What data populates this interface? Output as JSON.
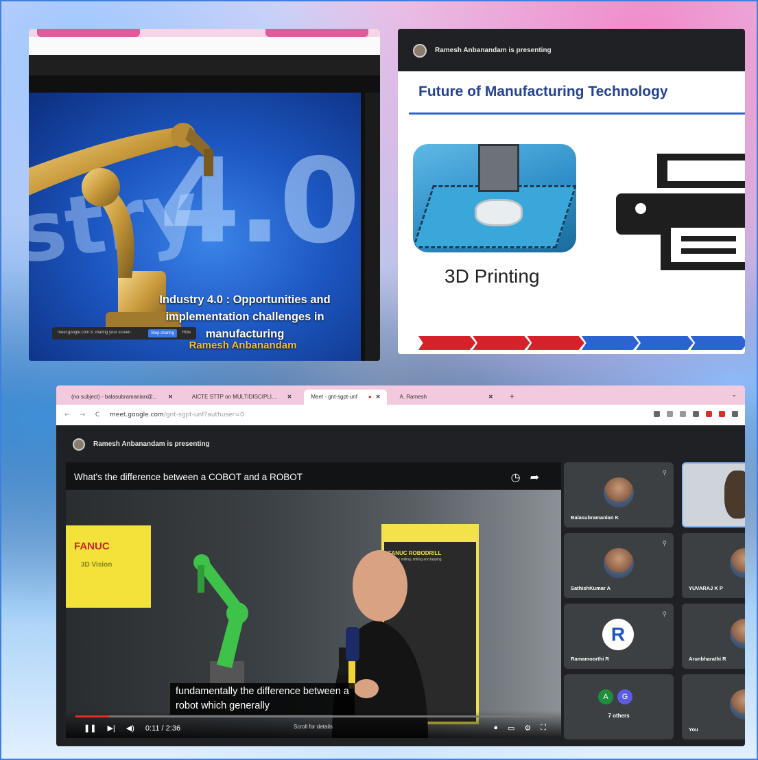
{
  "panel1": {
    "big_text": "4.0",
    "big_text_left": "stry",
    "caption": "Industry 4.0 : Opportunities and implementation challenges in manufacturing",
    "author": "Ramesh Anbanandam",
    "share_bar": {
      "text": "meet.google.com is sharing your screen.",
      "stop_button": "Stop sharing",
      "hide_button": "Hide"
    }
  },
  "panel2": {
    "presenter_text": "Ramesh Anbanandam is presenting",
    "slide_title": "Future of Manufacturing Technology",
    "slide_label": "3D Printing",
    "progress_steps": [
      {
        "label": "",
        "color": "#d6212b"
      },
      {
        "label": "",
        "color": "#d6212b"
      },
      {
        "label": "",
        "color": "#d6212b"
      },
      {
        "label": "",
        "color": "#2b63d1"
      },
      {
        "label": "",
        "color": "#2b63d1"
      },
      {
        "label": "",
        "color": "#2b63d1"
      }
    ]
  },
  "panel3": {
    "browser": {
      "tabs": [
        {
          "label": "(no subject) - balasubramanian@...",
          "active": false
        },
        {
          "label": "AICTE STTP on MULTIDISCIPLI...",
          "active": false
        },
        {
          "label": "Meet - gnt-sgpt-unf",
          "active": true
        },
        {
          "label": "A. Ramesh",
          "active": false
        }
      ],
      "url_host": "meet.google.com",
      "url_path": "/gnt-sgpt-unf?authuser=0"
    },
    "presenter_text": "Ramesh Anbanandam is presenting",
    "video": {
      "title": "What's the difference between a COBOT and a ROBOT",
      "brand": "FANUC",
      "brand_sub": "3D Vision",
      "poster_title": "FANUC ROBODRILL",
      "poster_sub": "Flexible milling, drilling and tapping",
      "subtitle_line1": "fundamentally the difference between a",
      "subtitle_line2": "robot which generally",
      "time": "0:11 / 2:36",
      "progress": 0.07,
      "scroll_hint": "Scroll for details"
    },
    "participants": [
      {
        "name": "Balasubramanian K",
        "kind": "face"
      },
      {
        "name": "",
        "kind": "camera"
      },
      {
        "name": "SathishKumar A",
        "kind": "face"
      },
      {
        "name": "YUVARAJ K P",
        "kind": "face"
      },
      {
        "name": "Ramamoorthi R",
        "kind": "letter",
        "letter": "R"
      },
      {
        "name": "Arunbharathi R",
        "kind": "face"
      },
      {
        "name": "7 others",
        "kind": "others",
        "avatars": [
          "A",
          "G"
        ]
      },
      {
        "name": "You",
        "kind": "face"
      }
    ]
  }
}
